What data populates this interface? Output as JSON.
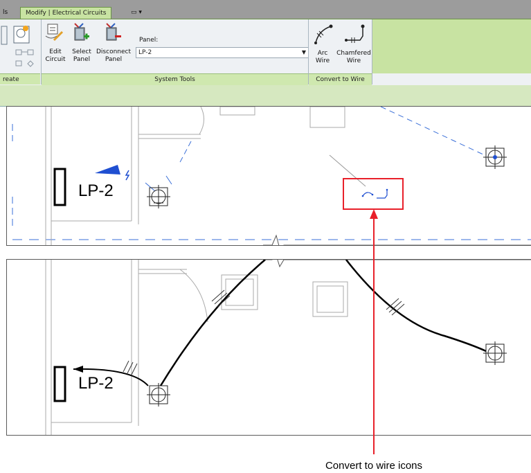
{
  "tabs": [
    {
      "label": "ls"
    },
    {
      "label": "Modify | Electrical Circuits"
    },
    {
      "label": "▭ ▾"
    }
  ],
  "ribbon": {
    "edit_circuit": "Edit Circuit",
    "edit_circuit_l1": "Edit",
    "edit_circuit_l2": "Circuit",
    "select_panel_l1": "Select",
    "select_panel_l2": "Panel",
    "disconnect_panel_l1": "Disconnect",
    "disconnect_panel_l2": "Panel",
    "panel_label": "Panel:",
    "panel_value": "LP-2",
    "arc_wire_l1": "Arc",
    "arc_wire_l2": "Wire",
    "chamfered_wire_l1": "Chamfered",
    "chamfered_wire_l2": "Wire",
    "groups": {
      "create": "reate",
      "system_tools": "System Tools",
      "convert_to_wire": "Convert to Wire"
    }
  },
  "views": {
    "top_panel_tag": "LP-2",
    "bottom_panel_tag": "LP-2"
  },
  "callout": {
    "caption": "Convert to wire icons",
    "color": "#e8202a"
  },
  "colors": {
    "ribbon_green": "#c8e3a2",
    "circuit_blue": "#1f4fd1",
    "wire_black": "#000000"
  }
}
